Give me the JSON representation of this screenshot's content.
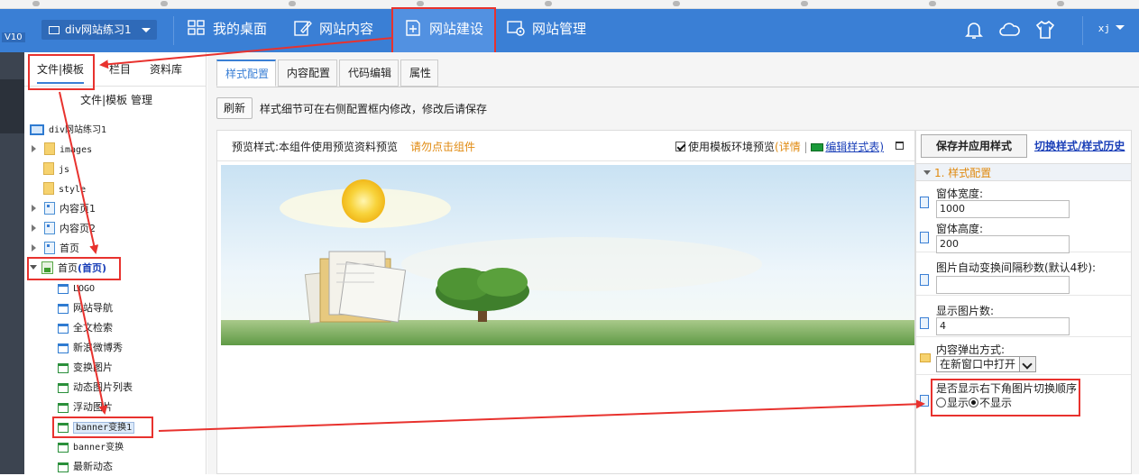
{
  "header": {
    "version_tag": "V10",
    "site_select": "div网站练习1",
    "nav": [
      {
        "label": "我的桌面",
        "icon": "grid-icon"
      },
      {
        "label": "网站内容",
        "icon": "edit-icon"
      },
      {
        "label": "网站建设",
        "icon": "build-icon"
      },
      {
        "label": "网站管理",
        "icon": "manage-icon"
      }
    ],
    "user": "xj",
    "colors": {
      "header_bg": "#3a7fd5",
      "active_nav": "#5291e1",
      "annotation": "#e8322e"
    }
  },
  "sidebar": {
    "tabs": [
      "文件|模板",
      "栏目",
      "资料库"
    ],
    "subtitle": "文件|模板 管理",
    "tree": {
      "root": "div网站练习1",
      "items": [
        {
          "label": "images",
          "icon": "image-folder-icon"
        },
        {
          "label": "js",
          "icon": "folder-icon"
        },
        {
          "label": "style",
          "icon": "style-folder-icon"
        },
        {
          "label": "内容页1",
          "icon": "page-icon"
        },
        {
          "label": "内容页2",
          "icon": "page-icon"
        },
        {
          "label": "首页",
          "icon": "page-icon"
        }
      ],
      "home_node": {
        "label": "首页",
        "badge": "(首页)"
      },
      "components": [
        "LOGO",
        "网站导航",
        "全文检索",
        "新浪微博秀",
        "变换图片",
        "动态图片列表",
        "浮动图片",
        "banner变换1",
        "banner变换",
        "最新动态"
      ]
    }
  },
  "main": {
    "tabs": [
      "样式配置",
      "内容配置",
      "代码编辑",
      "属性"
    ],
    "refresh_label": "刷新",
    "hint": "样式细节可在右侧配置框内修改，修改后请保存",
    "preview": {
      "label": "预览样式:本组件使用预览资料预览",
      "warning": "请勿点击组件",
      "use_template_env": "使用模板环境预览",
      "detail_link": "(详情",
      "edit_stylesheet": "编辑样式表)"
    }
  },
  "panel": {
    "save_button": "保存并应用样式",
    "switch_link": "切换样式/样式历史",
    "section_title": "1. 样式配置",
    "fields": {
      "width_label": "窗体宽度:",
      "width_value": "1000",
      "height_label": "窗体高度:",
      "height_value": "200",
      "interval_label": "图片自动变换间隔秒数(默认4秒):",
      "interval_value": "",
      "count_label": "显示图片数:",
      "count_value": "4",
      "popup_label": "内容弹出方式:",
      "popup_value": "在新窗口中打开",
      "order_label": "是否显示右下角图片切换顺序",
      "order_show": "显示",
      "order_hide": "不显示",
      "order_selected": "不显示"
    }
  }
}
